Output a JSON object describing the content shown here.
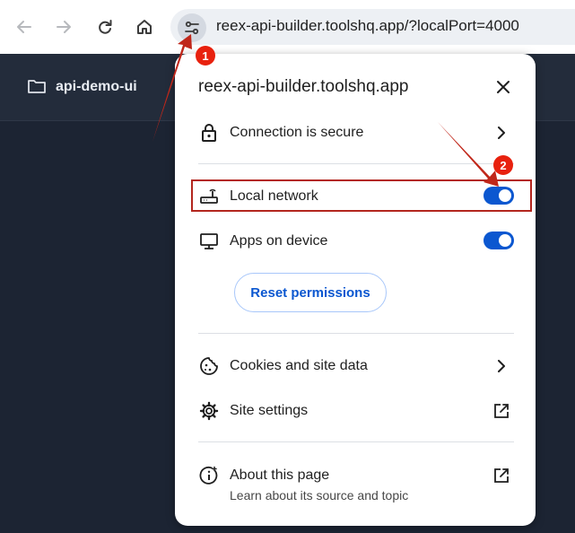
{
  "browser": {
    "url": "reex-api-builder.toolshq.app/?localPort=4000"
  },
  "page": {
    "project_name": "api-demo-ui"
  },
  "site_info_popup": {
    "title": "reex-api-builder.toolshq.app",
    "connection_label": "Connection is secure",
    "permissions": [
      {
        "label": "Local network",
        "enabled": true,
        "icon": "router-icon"
      },
      {
        "label": "Apps on device",
        "enabled": true,
        "icon": "monitor-icon"
      }
    ],
    "reset_button_label": "Reset permissions",
    "cookies_label": "Cookies and site data",
    "site_settings_label": "Site settings",
    "about_label": "About this page",
    "about_sublabel": "Learn about its source and topic"
  },
  "annotations": {
    "step1": "1",
    "step2": "2"
  },
  "colors": {
    "accent": "#0b57d0",
    "annotation_red": "#e8210e",
    "page_bg": "#1c2433"
  }
}
